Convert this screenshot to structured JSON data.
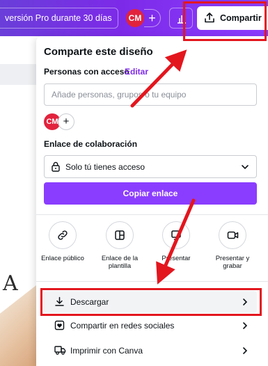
{
  "topbar": {
    "pro_text": "versión Pro durante 30 días",
    "avatar_initials": "CM",
    "add_symbol": "+",
    "share_label": "Compartir"
  },
  "panel": {
    "title": "Comparte este diseño",
    "people_label": "Personas con acceso",
    "edit_label": "Editar",
    "add_people_placeholder": "Añade personas, grupos o tu equipo",
    "avatar_initials": "CM",
    "add_symbol": "+",
    "collab_label": "Enlace de colaboración",
    "access_value": "Solo tú tienes acceso",
    "copy_button": "Copiar enlace",
    "options": [
      {
        "label": "Enlace público",
        "icon": "link-icon"
      },
      {
        "label": "Enlace de la plantilla",
        "icon": "template-icon"
      },
      {
        "label": "Presentar",
        "icon": "present-icon"
      },
      {
        "label": "Presentar y grabar",
        "icon": "record-icon"
      }
    ],
    "rows": [
      {
        "label": "Descargar",
        "icon": "download-icon"
      },
      {
        "label": "Compartir en redes sociales",
        "icon": "heart-icon"
      },
      {
        "label": "Imprimir con Canva",
        "icon": "truck-icon"
      }
    ]
  },
  "canvas": {
    "letter": "A"
  },
  "colors": {
    "brand_purple": "#8b3dff",
    "avatar_red": "#e2233d",
    "annotation_red": "#e3161e"
  }
}
